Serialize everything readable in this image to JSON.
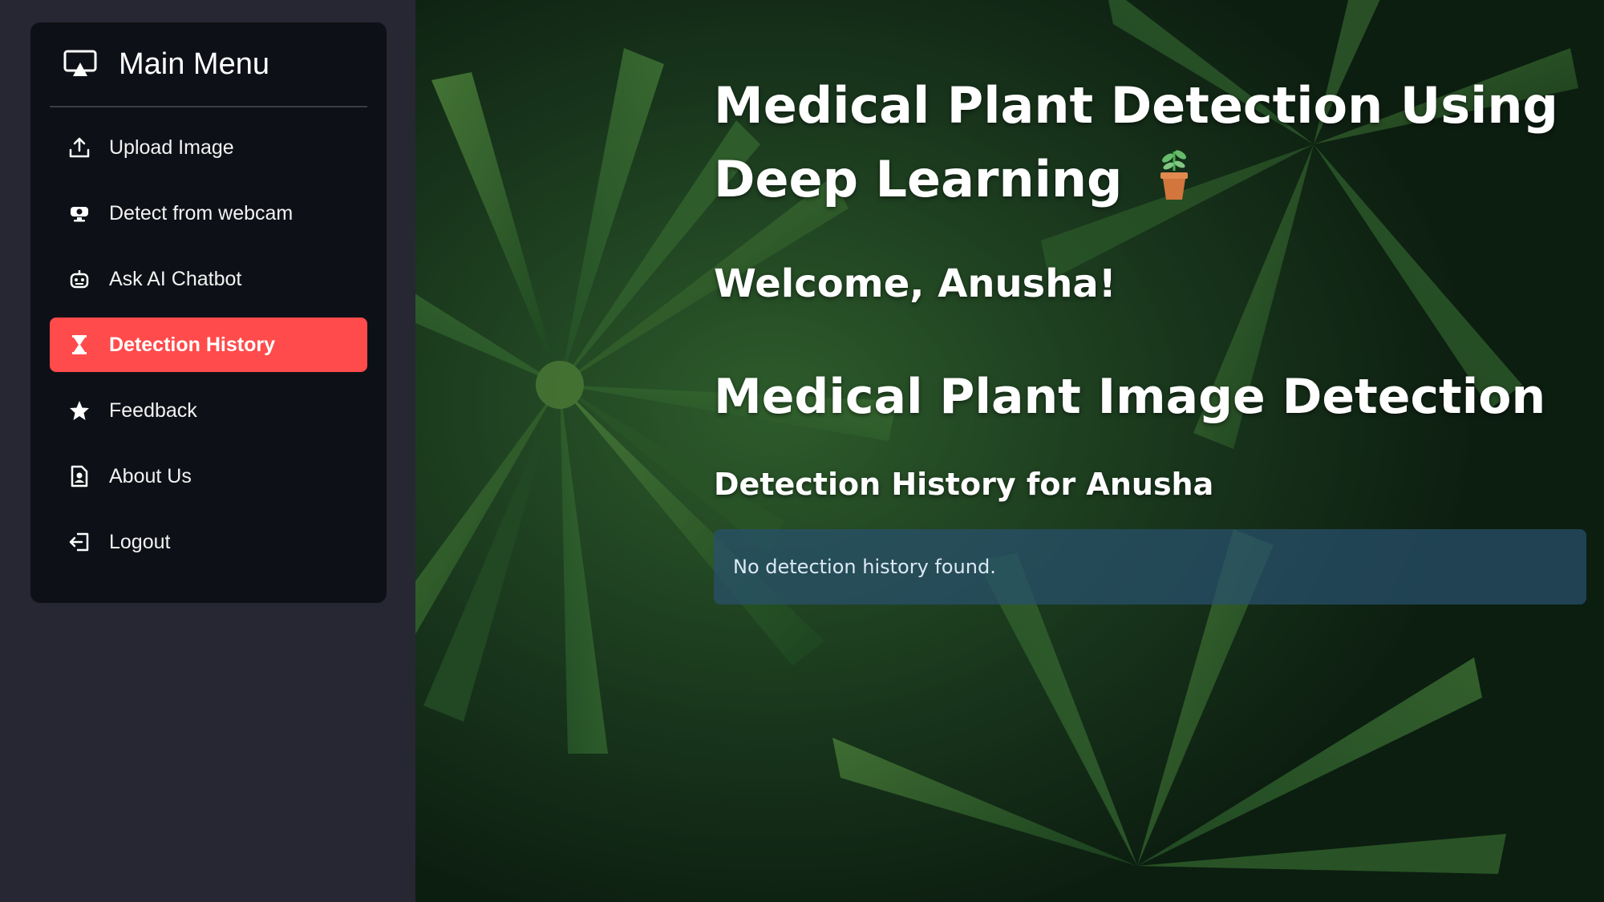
{
  "sidebar": {
    "title": "Main Menu",
    "title_icon": "monitor-icon",
    "items": [
      {
        "label": "Upload Image",
        "icon": "upload-icon",
        "active": false
      },
      {
        "label": "Detect from webcam",
        "icon": "webcam-icon",
        "active": false
      },
      {
        "label": "Ask AI Chatbot",
        "icon": "robot-icon",
        "active": false
      },
      {
        "label": "Detection History",
        "icon": "hourglass-icon",
        "active": true
      },
      {
        "label": "Feedback",
        "icon": "star-icon",
        "active": false
      },
      {
        "label": "About Us",
        "icon": "document-person-icon",
        "active": false
      },
      {
        "label": "Logout",
        "icon": "logout-icon",
        "active": false
      }
    ]
  },
  "main": {
    "title": "Medical Plant Detection Using Deep Learning",
    "title_icon": "potted-plant-icon",
    "welcome": "Welcome, Anusha!",
    "subtitle": "Medical Plant Image Detection",
    "history_title": "Detection History for Anusha",
    "info_message": "No detection history found."
  },
  "colors": {
    "sidebar_bg": "#262733",
    "menu_bg": "#0e1017",
    "active_item": "#ff4b4b",
    "info_box": "#28506e"
  }
}
